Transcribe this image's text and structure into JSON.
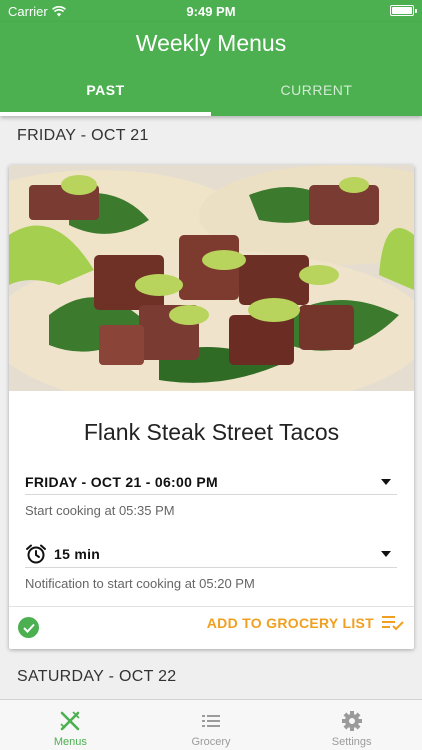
{
  "status": {
    "carrier": "Carrier",
    "time": "9:49 PM"
  },
  "header": {
    "title": "Weekly Menus"
  },
  "tabs": [
    {
      "label": "PAST",
      "active": true
    },
    {
      "label": "CURRENT",
      "active": false
    }
  ],
  "sections": [
    {
      "day": "FRIDAY - OCT 21"
    },
    {
      "day": "SATURDAY - OCT 22"
    }
  ],
  "card": {
    "title": "Flank Steak Street Tacos",
    "schedule_value": "FRIDAY - OCT 21 - 06:00 PM",
    "schedule_hint": "Start cooking at 05:35 PM",
    "reminder_value": "15 min",
    "reminder_hint": "Notification to start cooking at 05:20 PM",
    "grocery_label": "ADD TO GROCERY LIST"
  },
  "bottom_nav": [
    {
      "label": "Menus",
      "icon": "fork-knife-icon",
      "active": true
    },
    {
      "label": "Grocery",
      "icon": "list-icon",
      "active": false
    },
    {
      "label": "Settings",
      "icon": "gear-icon",
      "active": false
    }
  ],
  "colors": {
    "primary": "#4cb050",
    "accent": "#f0a020"
  }
}
